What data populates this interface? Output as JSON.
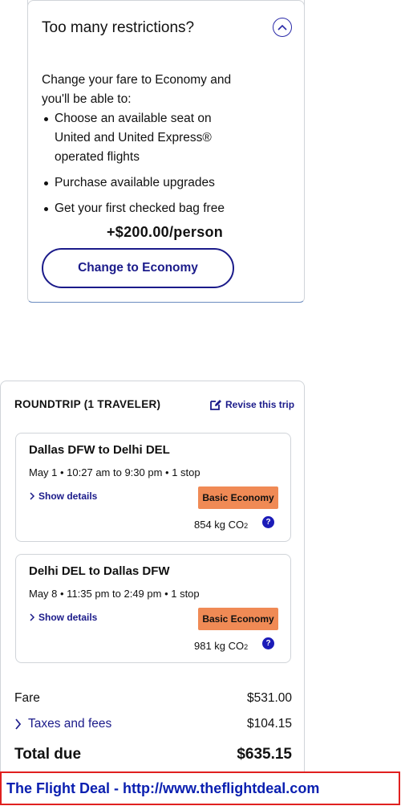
{
  "upgrade": {
    "title": "Too many restrictions?",
    "intro": "Change your fare to Economy and you'll be able to:",
    "benefits": [
      "Choose an available seat on United and United Express® operated flights",
      "Purchase available upgrades",
      "Get your first checked bag free"
    ],
    "price_delta": "+$200.00/person",
    "button_label": "Change to Economy",
    "collapse_icon": "chevron-up-icon"
  },
  "trip": {
    "header": "ROUNDTRIP (1 TRAVELER)",
    "revise_label": "Revise this trip",
    "flights": [
      {
        "route": "Dallas DFW to Delhi DEL",
        "times": "May 1 • 10:27 am to 9:30 pm • 1 stop",
        "details_label": "Show details",
        "fare_class": "Basic Economy",
        "co2_value": "854 kg CO",
        "co2_sub": "2",
        "help": "?"
      },
      {
        "route": "Delhi DEL to Dallas DFW",
        "times": "May 8 • 11:35 pm to 2:49 pm • 1 stop",
        "details_label": "Show details",
        "fare_class": "Basic Economy",
        "co2_value": "981 kg CO",
        "co2_sub": "2",
        "help": "?"
      }
    ],
    "fare_label": "Fare",
    "fare_value": "$531.00",
    "taxes_label": "Taxes and fees",
    "taxes_value": "$104.15",
    "total_label": "Total due",
    "total_value": "$635.15"
  },
  "banner": {
    "text": "The Flight Deal - http://www.theflightdeal.com"
  },
  "colors": {
    "brand_blue": "#1b1b8a",
    "basic_economy_badge": "#f08a55",
    "banner_border": "#e0201f",
    "banner_text": "#0a1fb0"
  }
}
